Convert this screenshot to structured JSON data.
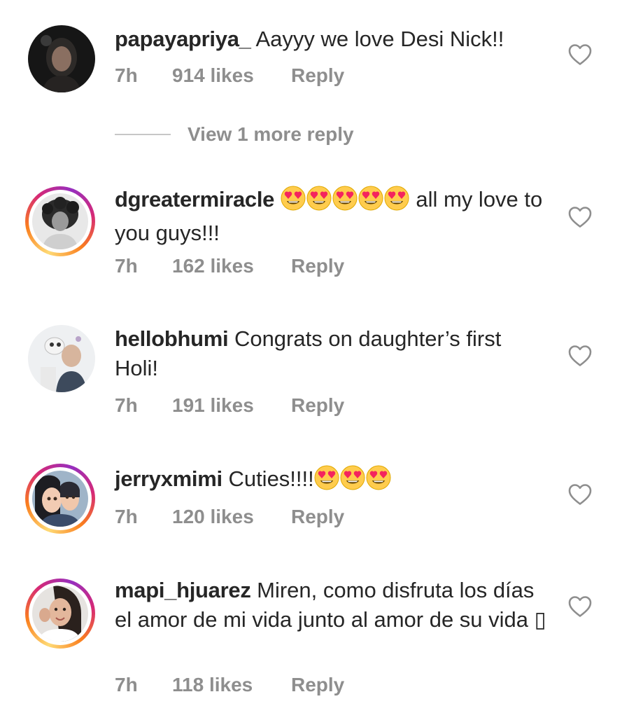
{
  "comments": [
    {
      "username": "papayapriya_",
      "text": " Aayyy we love Desi Nick!!",
      "time": "7h",
      "likes": "914 likes",
      "reply": "Reply",
      "story_ring": false
    },
    {
      "username": "dgreatermiracle",
      "emojis": [
        "heart-eyes",
        "heart-eyes",
        "heart-eyes",
        "heart-eyes",
        "heart-eyes"
      ],
      "text": " all my love to you guys!!!",
      "time": "7h",
      "likes": "162 likes",
      "reply": "Reply",
      "story_ring": true
    },
    {
      "username": "hellobhumi",
      "text": " Congrats on daughter’s first Holi!",
      "time": "7h",
      "likes": "191 likes",
      "reply": "Reply",
      "story_ring": false
    },
    {
      "username": "jerryxmimi",
      "text": " Cuties!!!!",
      "emojis": [
        "heart-eyes",
        "heart-eyes",
        "heart-eyes"
      ],
      "time": "7h",
      "likes": "120 likes",
      "reply": "Reply",
      "story_ring": true
    },
    {
      "username": "mapi_hjuarez",
      "text": " Miren, como disfruta los días el amor de mi vida junto al amor de su vida ",
      "trailing_glyph": "▯",
      "time": "7h",
      "likes": "118 likes",
      "reply": "Reply",
      "story_ring": true
    }
  ],
  "view_more_replies": "View 1 more reply",
  "icons": {
    "like": "heart-outline-icon",
    "emoji": "smiling-face-with-heart-eyes"
  },
  "colors": {
    "text": "#262626",
    "meta": "#8e8e8e",
    "divider": "#c7c7c7",
    "heart_stroke": "#8e8e8e",
    "emoji_face": "#ffcc4d",
    "emoji_heart": "#f4245e",
    "ring_gradient": [
      "#feda75",
      "#fa7e1e",
      "#d62976",
      "#962fbf"
    ]
  }
}
